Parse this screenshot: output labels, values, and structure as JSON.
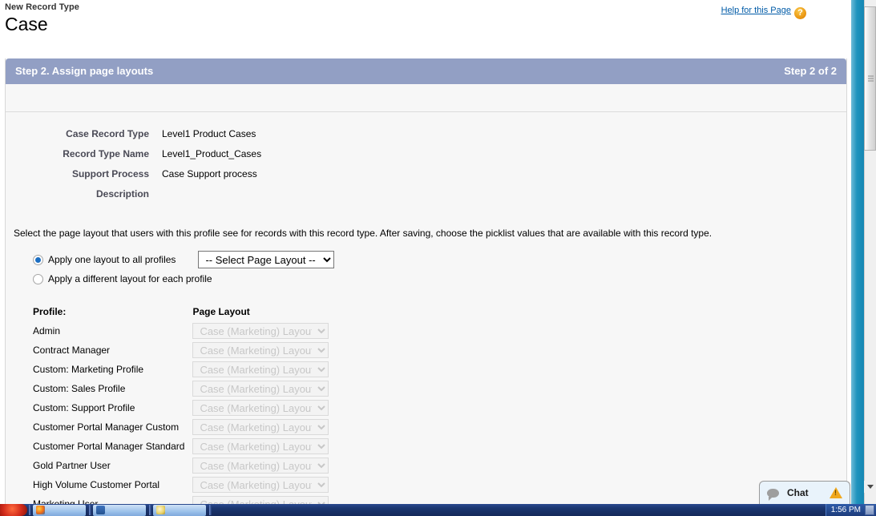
{
  "page": {
    "kicker": "New Record Type",
    "title": "Case",
    "help_link": "Help for this Page",
    "help_icon_glyph": "?"
  },
  "step_panel": {
    "title": "Step 2. Assign page layouts",
    "step_counter": "Step 2 of 2"
  },
  "details": [
    {
      "label": "Case Record Type",
      "value": "Level1 Product Cases"
    },
    {
      "label": "Record Type Name",
      "value": "Level1_Product_Cases"
    },
    {
      "label": "Support Process",
      "value": "Case Support process"
    },
    {
      "label": "Description",
      "value": ""
    }
  ],
  "instruction": "Select the page layout that users with this profile see for records with this record type. After saving, choose the picklist values that are available with this record type.",
  "options": {
    "apply_one": {
      "label": "Apply one layout to all profiles",
      "checked": true
    },
    "apply_each": {
      "label": "Apply a different layout for each profile",
      "checked": false
    },
    "global_layout_select": {
      "value": "-- Select Page Layout --",
      "options": [
        "-- Select Page Layout --"
      ]
    }
  },
  "profile_table": {
    "headers": {
      "profile": "Profile:",
      "layout": "Page Layout"
    },
    "rows": [
      {
        "profile": "Admin",
        "layout": "Case (Marketing) Layout"
      },
      {
        "profile": "Contract Manager",
        "layout": "Case (Marketing) Layout"
      },
      {
        "profile": "Custom: Marketing Profile",
        "layout": "Case (Marketing) Layout"
      },
      {
        "profile": "Custom: Sales Profile",
        "layout": "Case (Marketing) Layout"
      },
      {
        "profile": "Custom: Support Profile",
        "layout": "Case (Marketing) Layout"
      },
      {
        "profile": "Customer Portal Manager Custom",
        "layout": "Case (Marketing) Layout"
      },
      {
        "profile": "Customer Portal Manager Standard",
        "layout": "Case (Marketing) Layout"
      },
      {
        "profile": "Gold Partner User",
        "layout": "Case (Marketing) Layout"
      },
      {
        "profile": "High Volume Customer Portal",
        "layout": "Case (Marketing) Layout"
      },
      {
        "profile": "Marketing User",
        "layout": "Case (Marketing) Layout"
      }
    ]
  },
  "chat_widget": {
    "label": "Chat",
    "bubble_icon": "chat-bubble-icon",
    "warning_icon": "warning-triangle-icon"
  },
  "taskbar": {
    "clock": "1:56 PM",
    "buttons": [
      {
        "icon": "firefox-icon"
      },
      {
        "icon": "folder-icon"
      },
      {
        "icon": "paint-icon"
      }
    ]
  },
  "colors": {
    "panel_header": "#929fc4",
    "link": "#015ba7",
    "browser_strip": "#1f93bd",
    "radio_dot": "#1b6ec2",
    "warning": "#f0a81e"
  }
}
